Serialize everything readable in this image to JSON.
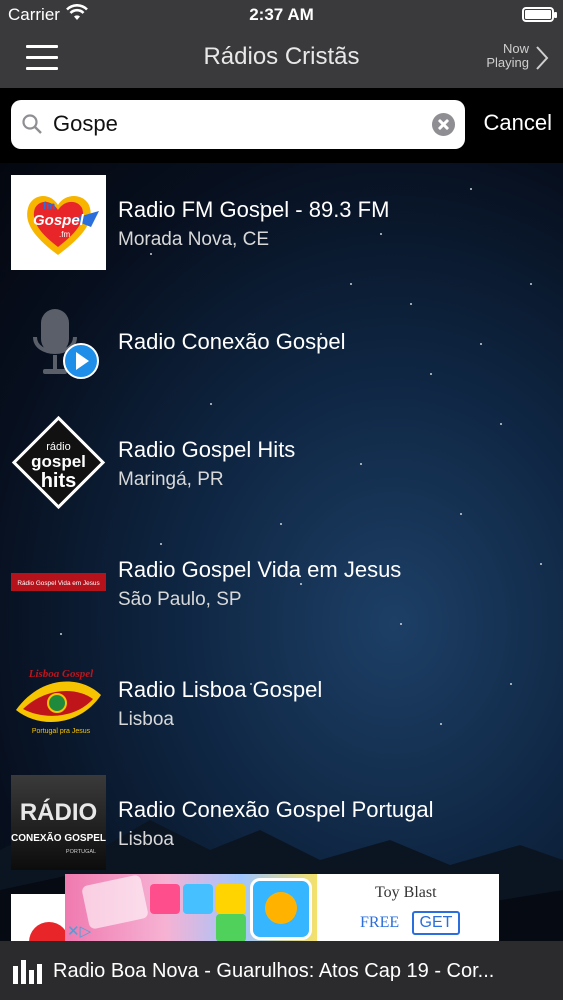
{
  "status": {
    "carrier": "Carrier",
    "time": "2:37 AM"
  },
  "nav": {
    "title": "Rádios Cristãs",
    "now_line1": "Now",
    "now_line2": "Playing"
  },
  "search": {
    "value": "Gospe",
    "cancel_label": "Cancel"
  },
  "stations": [
    {
      "name": "Radio FM Gospel - 89.3 FM",
      "location": "Morada Nova, CE",
      "logo": "fm-gospel-logo"
    },
    {
      "name": "Radio Conexão Gospel",
      "location": "",
      "logo": "microphone-play-logo"
    },
    {
      "name": "Radio Gospel Hits",
      "location": "Maringá, PR",
      "logo": "gospel-hits-logo"
    },
    {
      "name": "Radio Gospel Vida em Jesus",
      "location": "São Paulo, SP",
      "logo": "vida-em-jesus-logo"
    },
    {
      "name": "Radio Lisboa Gospel",
      "location": "Lisboa",
      "logo": "lisboa-gospel-logo"
    },
    {
      "name": "Radio Conexão Gospel Portugal",
      "location": "Lisboa",
      "logo": "conexao-portugal-logo"
    }
  ],
  "logo_text": {
    "fm_gospel_top": "fm",
    "fm_gospel_mid": "Gospel",
    "fm_gospel_bot": ".fm",
    "gospel_hits_1": "rádio",
    "gospel_hits_2": "gospel",
    "gospel_hits_3": "hits",
    "vida_em_jesus": "Rádio Gospel Vida em Jesus",
    "lisboa_1": "Lisboa Gospel",
    "lisboa_2": "Portugal pra Jesus",
    "conexao_1": "RÁDIO",
    "conexao_2": "CONEXÃO GOSPEL",
    "conexao_3": "PORTUGAL"
  },
  "ad": {
    "brand": "Toy Blast",
    "free": "FREE",
    "get": "GET"
  },
  "player": {
    "now_playing": "Radio Boa Nova - Guarulhos: Atos Cap 19 - Cor..."
  }
}
